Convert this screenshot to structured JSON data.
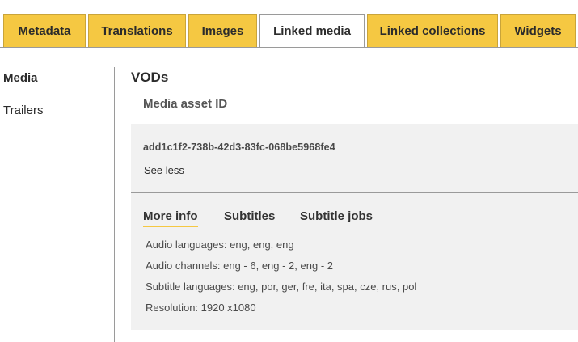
{
  "tabs": [
    "Metadata",
    "Translations",
    "Images",
    "Linked media",
    "Linked collections",
    "Widgets"
  ],
  "active_tab": "Linked media",
  "sidebar": {
    "items": [
      "Media",
      "Trailers"
    ],
    "active": "Media"
  },
  "main": {
    "section_title": "VODs",
    "asset_heading": "Media asset ID",
    "asset_id": "add1c1f2-738b-42d3-83fc-068be5968fe4",
    "see_less": "See less",
    "subtabs": [
      "More info",
      "Subtitles",
      "Subtitle jobs"
    ],
    "active_subtab": "More info",
    "info": {
      "audio_languages": "Audio languages: eng, eng, eng",
      "audio_channels": "Audio channels: eng - 6, eng - 2, eng - 2",
      "subtitle_languages": "Subtitle languages: eng, por, ger, fre, ita, spa, cze, rus, pol",
      "resolution": "Resolution: 1920 x1080"
    }
  },
  "colors": {
    "tab_yellow": "#f5c842",
    "text": "#2b2b2b",
    "panel_bg": "#f1f1f1",
    "divider": "#9a9a9a"
  }
}
